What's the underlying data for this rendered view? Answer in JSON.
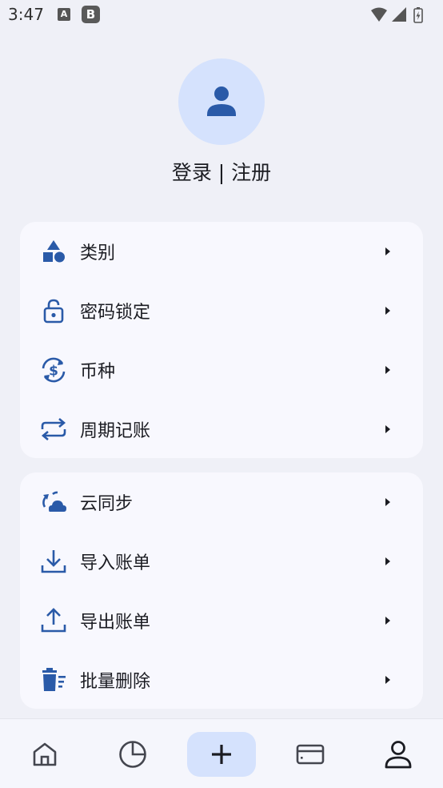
{
  "status_bar": {
    "time": "3:47",
    "icon_a": "A",
    "icon_b": "B",
    "icons": [
      "wifi-icon",
      "signal-icon",
      "battery-icon"
    ]
  },
  "profile": {
    "login_text": "登录 | 注册",
    "avatar_icon": "person-icon"
  },
  "card_1": {
    "items": [
      {
        "label": "类别",
        "icon": "shapes-icon"
      },
      {
        "label": "密码锁定",
        "icon": "lock-icon"
      },
      {
        "label": "币种",
        "icon": "currency-exchange-icon"
      },
      {
        "label": "周期记账",
        "icon": "repeat-icon"
      }
    ]
  },
  "card_2": {
    "items": [
      {
        "label": "云同步",
        "icon": "cloud-sync-icon"
      },
      {
        "label": "导入账单",
        "icon": "download-icon"
      },
      {
        "label": "导出账单",
        "icon": "upload-icon"
      },
      {
        "label": "批量删除",
        "icon": "delete-sweep-icon"
      }
    ]
  },
  "bottom_nav": {
    "items": [
      "home-icon",
      "pie-chart-icon",
      "add-icon",
      "wallet-icon",
      "profile-icon"
    ],
    "active": "profile-icon"
  },
  "colors": {
    "background": "#eff0f7",
    "card": "#f8f8fe",
    "accent": "#2a5aa8",
    "accent_light": "#d5e2fd"
  }
}
